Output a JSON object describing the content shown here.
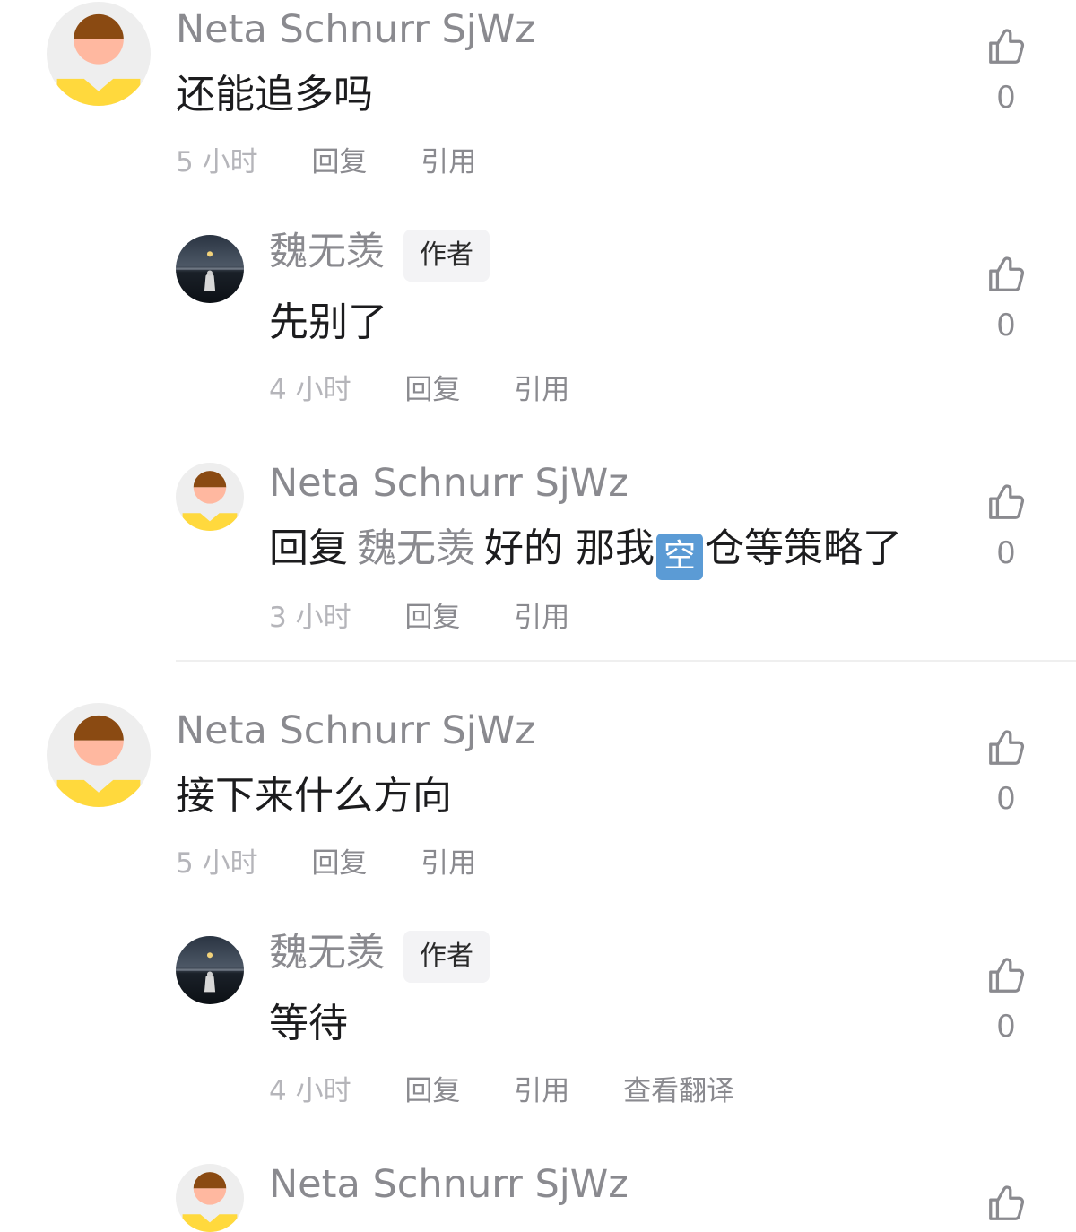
{
  "thread": [
    {
      "kind": "comment",
      "name": "Neta Schnurr SjWz",
      "text": "还能追多吗",
      "time": "5 小时",
      "actions": [
        "回复",
        "引用"
      ],
      "likes": "0"
    },
    {
      "kind": "reply",
      "name": "魏无羡",
      "badge": "作者",
      "text": "先别了",
      "time": "4 小时",
      "actions": [
        "回复",
        "引用"
      ],
      "likes": "0"
    },
    {
      "kind": "reply",
      "name": "Neta Schnurr SjWz",
      "reply_prefix": "回复",
      "reply_target": "魏无羡",
      "text_before_emoji": "好的 那我",
      "emoji": "空",
      "text_after_emoji": "仓等策略了",
      "time": "3 小时",
      "actions": [
        "回复",
        "引用"
      ],
      "likes": "0"
    },
    {
      "kind": "comment",
      "name": "Neta Schnurr SjWz",
      "text": "接下来什么方向",
      "time": "5 小时",
      "actions": [
        "回复",
        "引用"
      ],
      "likes": "0"
    },
    {
      "kind": "reply",
      "name": "魏无羡",
      "badge": "作者",
      "text": "等待",
      "time": "4 小时",
      "actions": [
        "回复",
        "引用",
        "查看翻译"
      ],
      "likes": "0"
    },
    {
      "kind": "reply",
      "name": "Neta Schnurr SjWz"
    }
  ],
  "icons": {
    "like": "thumbs-up-icon",
    "default_avatar": "cartoon-avatar",
    "author_avatar": "night-photo-avatar"
  },
  "colors": {
    "avatar_bg": "#eeeeee",
    "avatar_hair": "#8a4a12",
    "avatar_face": "#ffb8a0",
    "avatar_shirt": "#ffd93d",
    "emoji_bg": "#5b9bd5"
  }
}
